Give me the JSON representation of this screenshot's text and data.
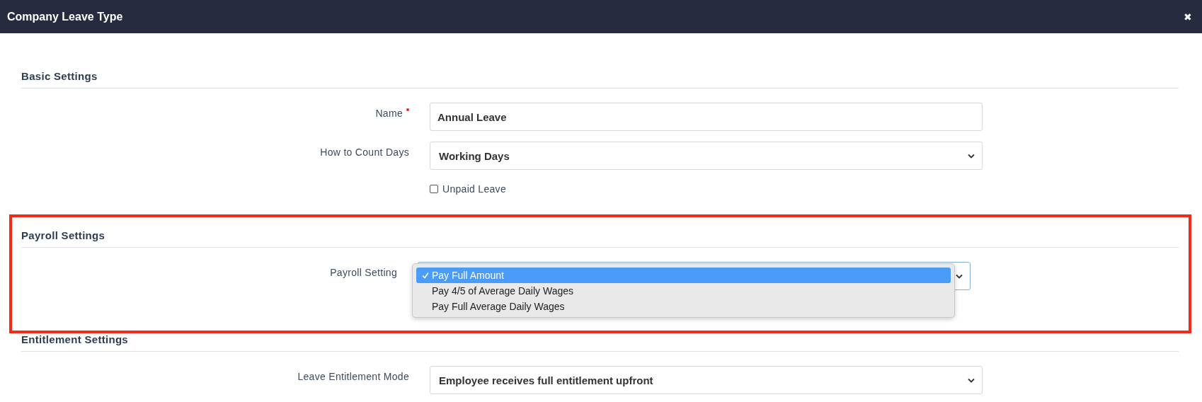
{
  "window": {
    "title": "Company Leave Type",
    "close": "✖"
  },
  "sections": [
    {
      "title": "Basic Settings",
      "highlighted": false,
      "fields": [
        {
          "kind": "text",
          "label": "Name",
          "required": true,
          "value": "Annual Leave"
        },
        {
          "kind": "select",
          "label": "How to Count Days",
          "required": false,
          "value": "Working Days"
        },
        {
          "kind": "checkbox",
          "label": "Unpaid Leave",
          "checked": false
        }
      ]
    },
    {
      "title": "Payroll Settings",
      "highlighted": true,
      "fields": [
        {
          "kind": "select",
          "label": "Payroll Setting",
          "required": false,
          "focused": true,
          "menu": [
            {
              "label": "Pay Full Amount",
              "selected": true
            },
            {
              "label": "Pay 4/5 of Average Daily Wages",
              "selected": false
            },
            {
              "label": "Pay Full Average Daily Wages",
              "selected": false
            }
          ]
        }
      ]
    },
    {
      "title": "Entitlement Settings",
      "highlighted": false,
      "fields": [
        {
          "kind": "select",
          "label": "Leave Entitlement Mode",
          "required": false,
          "value": "Employee receives full entitlement upfront"
        }
      ]
    }
  ]
}
